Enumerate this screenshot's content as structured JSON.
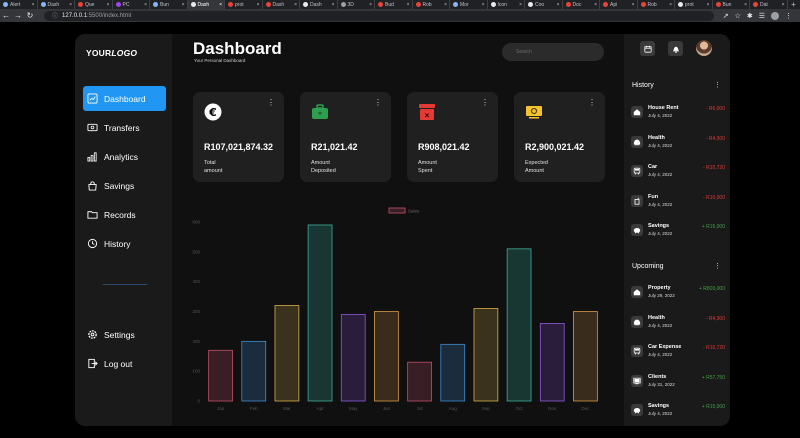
{
  "browser": {
    "tabs": [
      {
        "label": "Alert",
        "color": "#8ab4f8"
      },
      {
        "label": "Dash",
        "color": "#8ab4f8"
      },
      {
        "label": "Que",
        "color": "#ea4335"
      },
      {
        "label": "PC",
        "color": "#a142f4"
      },
      {
        "label": "Bun",
        "color": "#8ab4f8"
      },
      {
        "label": "Dash",
        "color": "#e8eaed",
        "active": true
      },
      {
        "label": "prot",
        "color": "#ea4335"
      },
      {
        "label": "Dash",
        "color": "#ea4335"
      },
      {
        "label": "Dash",
        "color": "#e8eaed"
      },
      {
        "label": "3D",
        "color": "#9aa0a6"
      },
      {
        "label": "Bud",
        "color": "#ea4335"
      },
      {
        "label": "Rob",
        "color": "#ea4335"
      },
      {
        "label": "Mor",
        "color": "#8ab4f8"
      },
      {
        "label": "Icon",
        "color": "#e8eaed"
      },
      {
        "label": "Coo",
        "color": "#e8eaed"
      },
      {
        "label": "Doc",
        "color": "#ea4335"
      },
      {
        "label": "Api",
        "color": "#ea4335"
      },
      {
        "label": "Rob",
        "color": "#ea4335"
      },
      {
        "label": "prot",
        "color": "#e8eaed"
      },
      {
        "label": "Bun",
        "color": "#ea4335"
      },
      {
        "label": "Dat",
        "color": "#ea4335"
      }
    ],
    "url_host": "127.0.0.1",
    "url_path": ":5500/index.html"
  },
  "sidebar": {
    "logo_plain": "YOUR",
    "logo_bold": "LOGO",
    "items": [
      {
        "label": "Dashboard",
        "icon": "dashboard-icon",
        "active": true
      },
      {
        "label": "Transfers",
        "icon": "transfers-icon"
      },
      {
        "label": "Analytics",
        "icon": "analytics-icon"
      },
      {
        "label": "Savings",
        "icon": "savings-icon"
      },
      {
        "label": "Records",
        "icon": "records-icon"
      },
      {
        "label": "History",
        "icon": "history-icon"
      }
    ],
    "bottom": [
      {
        "label": "Settings",
        "icon": "settings-icon"
      },
      {
        "label": "Log out",
        "icon": "logout-icon"
      }
    ]
  },
  "header": {
    "title": "Dashboard",
    "subtitle": "Your Personal Dashboard",
    "search_placeholder": "Search"
  },
  "cards": [
    {
      "amount": "R107,021,874.32",
      "label_line1": "Total",
      "label_line2": "amount",
      "icon": "euro-icon",
      "icon_color": "#ffffff"
    },
    {
      "amount": "R21,021.42",
      "label_line1": "Amount",
      "label_line2": "Deposited",
      "icon": "briefcase-icon",
      "icon_color": "#2e9e4f"
    },
    {
      "amount": "R908,021.42",
      "label_line1": "Amount",
      "label_line2": "Spent",
      "icon": "wallet-icon",
      "icon_color": "#e53935"
    },
    {
      "amount": "R2,900,021.42",
      "label_line1": "Expected",
      "label_line2": "Amount",
      "icon": "money-icon",
      "icon_color": "#f4c430"
    }
  ],
  "chart_data": {
    "type": "bar",
    "categories": [
      "Jan",
      "Feb",
      "Mar",
      "Apr",
      "May",
      "Jun",
      "Jul",
      "Aug",
      "Sep",
      "Oct",
      "Nov",
      "Dec"
    ],
    "series": [
      {
        "name": "Sales",
        "values": [
          170,
          200,
          320,
          590,
          290,
          300,
          130,
          190,
          310,
          510,
          260,
          300
        ]
      }
    ],
    "yticks": [
      0,
      100,
      200,
      300,
      400,
      500,
      600
    ],
    "ylim": [
      0,
      600
    ],
    "legend": "top-center",
    "grid": false,
    "colors": [
      {
        "fill": "#3a1e25",
        "stroke": "#c2506a"
      },
      {
        "fill": "#1b2c3c",
        "stroke": "#3d8bd0"
      },
      {
        "fill": "#3a321c",
        "stroke": "#d8b04a"
      },
      {
        "fill": "#183632",
        "stroke": "#3fae9a"
      },
      {
        "fill": "#2a1d3c",
        "stroke": "#8a5cd6"
      },
      {
        "fill": "#3a2c1c",
        "stroke": "#d99a4a"
      },
      {
        "fill": "#3a1e25",
        "stroke": "#c2506a"
      },
      {
        "fill": "#1b2c3c",
        "stroke": "#3d8bd0"
      },
      {
        "fill": "#3a321c",
        "stroke": "#d8b04a"
      },
      {
        "fill": "#183632",
        "stroke": "#3fae9a"
      },
      {
        "fill": "#2a1d3c",
        "stroke": "#8a5cd6"
      },
      {
        "fill": "#3a2c1c",
        "stroke": "#d99a4a"
      }
    ]
  },
  "history": {
    "title": "History",
    "items": [
      {
        "name": "House Rent",
        "date": "July 4, 2022",
        "amount": "- R6,000",
        "kind": "neg",
        "icon": "home-icon"
      },
      {
        "name": "Health",
        "date": "July 4, 2022",
        "amount": "- R4,300",
        "kind": "neg",
        "icon": "health-icon"
      },
      {
        "name": "Car",
        "date": "July 4, 2022",
        "amount": "- R10,720",
        "kind": "neg",
        "icon": "car-icon"
      },
      {
        "name": "Fun",
        "date": "July 4, 2022",
        "amount": "- R10,000",
        "kind": "neg",
        "icon": "fun-icon"
      },
      {
        "name": "Savings",
        "date": "July 4, 2022",
        "amount": "+ R15,000",
        "kind": "pos",
        "icon": "piggy-bank-icon"
      }
    ]
  },
  "upcoming": {
    "title": "Upcoming",
    "items": [
      {
        "name": "Property",
        "date": "July 29, 2022",
        "amount": "+ R803,000",
        "kind": "pos",
        "icon": "home-icon"
      },
      {
        "name": "Health",
        "date": "July 4, 2022",
        "amount": "- R4,300",
        "kind": "neg",
        "icon": "health-icon"
      },
      {
        "name": "Car Expense",
        "date": "July 4, 2022",
        "amount": "- R10,720",
        "kind": "neg",
        "icon": "car-icon"
      },
      {
        "name": "Clients",
        "date": "July 31, 2022",
        "amount": "+ R57,750",
        "kind": "pos",
        "icon": "clients-icon"
      },
      {
        "name": "Savings",
        "date": "July 4, 2022",
        "amount": "+ R15,000",
        "kind": "pos",
        "icon": "piggy-bank-icon"
      }
    ]
  }
}
